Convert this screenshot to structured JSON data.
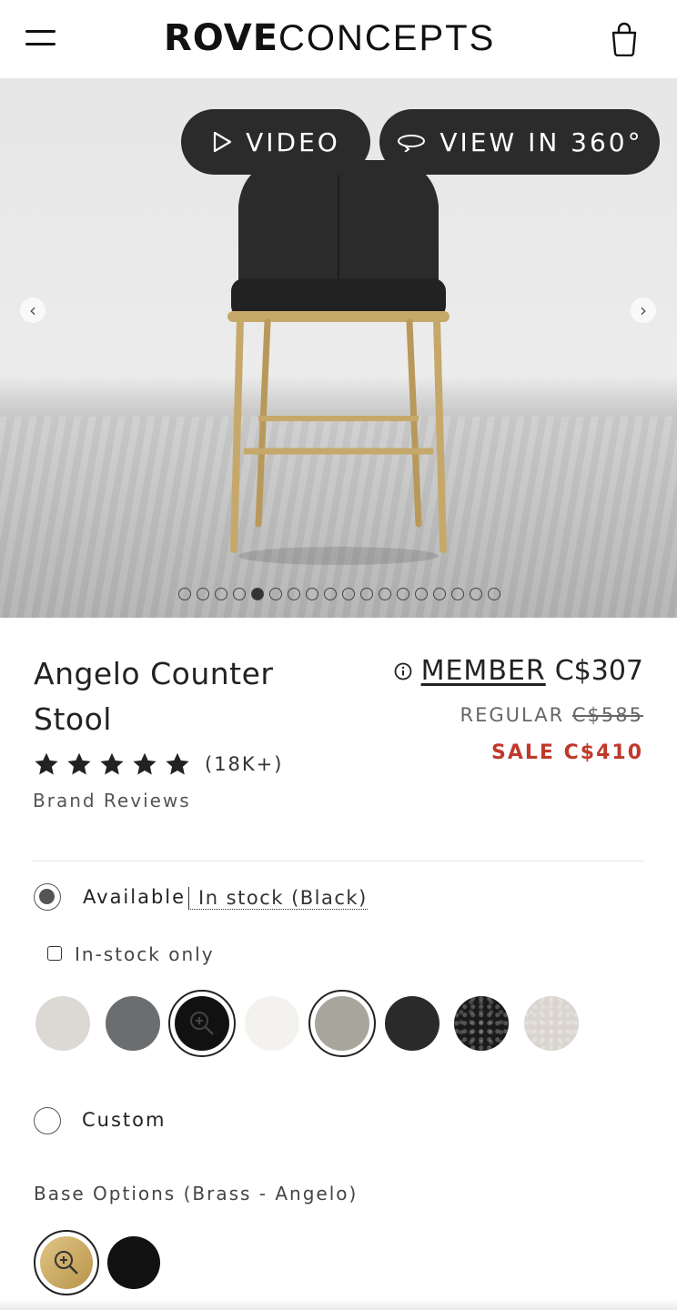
{
  "header": {
    "logo_bold": "ROVE",
    "logo_light": "CONCEPTS"
  },
  "hero": {
    "video_label": "VIDEO",
    "view360_label": "VIEW IN 360°",
    "slide_count": 18,
    "active_slide": 5
  },
  "product": {
    "title": "Angelo Counter Stool",
    "rating_stars": 5,
    "review_count": "(18K+)",
    "brand_reviews": "Brand Reviews",
    "member_label": "MEMBER",
    "member_price": "C$307",
    "regular_label": "REGULAR",
    "regular_price": "C$585",
    "sale_label": "SALE C$410",
    "sale_color": "#c0392b"
  },
  "availability": {
    "available_label": "Available",
    "stock_link": "In stock (Black)",
    "instock_only": "In-stock only",
    "custom_label": "Custom"
  },
  "swatches": [
    {
      "name": "light-gray",
      "color": "#dcd9d4"
    },
    {
      "name": "slate",
      "color": "#6b6e70"
    },
    {
      "name": "black",
      "color": "#111111"
    },
    {
      "name": "ivory",
      "color": "#f3f2ee"
    },
    {
      "name": "sage-gray",
      "color": "#a8a69c"
    },
    {
      "name": "charcoal",
      "color": "#2a2a2a"
    },
    {
      "name": "black-boucle",
      "color": "#1a1a1a"
    },
    {
      "name": "white-boucle",
      "color": "#d9d4ce"
    }
  ],
  "base_options": {
    "label": "Base Options (Brass - Angelo)",
    "items": [
      {
        "name": "brass",
        "color": "#c9a85a"
      },
      {
        "name": "black",
        "color": "#111111"
      }
    ]
  }
}
